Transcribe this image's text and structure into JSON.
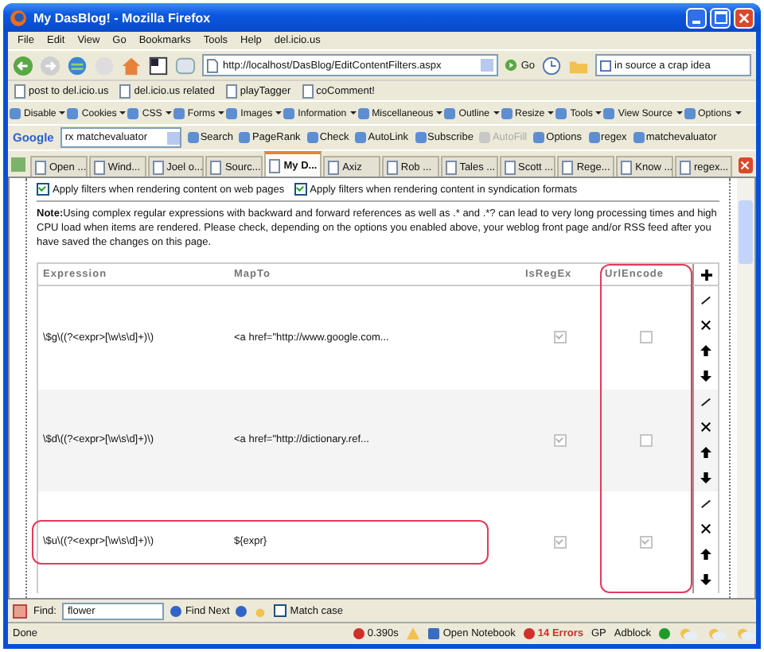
{
  "window": {
    "title": "My DasBlog! - Mozilla Firefox"
  },
  "menu": [
    "File",
    "Edit",
    "View",
    "Go",
    "Bookmarks",
    "Tools",
    "Help",
    "del.icio.us"
  ],
  "nav": {
    "url": "http://localhost/DasBlog/EditContentFilters.aspx",
    "go": "Go",
    "search_value": "in source a crap idea"
  },
  "bookmarks": [
    "post to del.icio.us",
    "del.icio.us related",
    "playTagger",
    "coComment!"
  ],
  "webdev_toolbar": [
    "Disable",
    "Cookies",
    "CSS",
    "Forms",
    "Images",
    "Information",
    "Miscellaneous",
    "Outline",
    "Resize",
    "Tools",
    "View Source",
    "Options"
  ],
  "google_toolbar": {
    "brand": "Google",
    "query": "rx matchevaluator",
    "items": [
      {
        "label": "Search",
        "disabled": false
      },
      {
        "label": "PageRank",
        "disabled": false
      },
      {
        "label": "Check",
        "disabled": false
      },
      {
        "label": "AutoLink",
        "disabled": false
      },
      {
        "label": "Subscribe",
        "disabled": false
      },
      {
        "label": "AutoFill",
        "disabled": true
      },
      {
        "label": "Options",
        "disabled": false
      },
      {
        "label": "regex",
        "disabled": false
      },
      {
        "label": "matchevaluator",
        "disabled": false
      }
    ]
  },
  "tabs": [
    {
      "label": "Open ...",
      "selected": false
    },
    {
      "label": "Wind...",
      "selected": false
    },
    {
      "label": "Joel o...",
      "selected": false
    },
    {
      "label": "Sourc...",
      "selected": false
    },
    {
      "label": "My D...",
      "selected": true
    },
    {
      "label": "Axiz",
      "selected": false
    },
    {
      "label": "Rob ...",
      "selected": false
    },
    {
      "label": "Tales ...",
      "selected": false
    },
    {
      "label": "Scott ...",
      "selected": false
    },
    {
      "label": "Rege...",
      "selected": false
    },
    {
      "label": "Know ...",
      "selected": false
    },
    {
      "label": "regex...",
      "selected": false
    }
  ],
  "options": [
    {
      "label": "Apply filters when rendering content on web pages",
      "checked": true
    },
    {
      "label": "Apply filters when rendering content in syndication formats",
      "checked": true
    }
  ],
  "note": "**Note:**Using complex regular expressions with backward and forward references as well as .* and .*? can lead to very long processing times and high CPU load when items are rendered. Please check, depending on the options you enabled above, your weblog front page and/or RSS feed after you have saved the changes on this page.",
  "table": {
    "columns": [
      {
        "label": "Expression",
        "highlighted": false
      },
      {
        "label": "MapTo",
        "highlighted": false
      },
      {
        "label": "IsRegEx",
        "highlighted": false
      },
      {
        "label": "UrlEncode",
        "highlighted": true
      }
    ],
    "rows": [
      {
        "expression": "\\$g\\((?<expr>[\\w\\s\\d]+)\\)",
        "map_to": "<a href=\"http://www.google.com...",
        "is_regex": true,
        "url_encode": false,
        "highlighted": false
      },
      {
        "expression": "\\$d\\((?<expr>[\\w\\s\\d]+)\\)",
        "map_to": "<a href=\"http://dictionary.ref...",
        "is_regex": true,
        "url_encode": false,
        "highlighted": false
      },
      {
        "expression": "\\$u\\((?<expr>[\\w\\s\\d]+)\\)",
        "map_to": "${expr}",
        "is_regex": true,
        "url_encode": true,
        "highlighted": true
      }
    ]
  },
  "find_bar": {
    "label": "Find:",
    "value": "flower",
    "find_next": "Find Next",
    "match_case": {
      "label": "Match case",
      "checked": false
    }
  },
  "status_bar": {
    "text": "Done",
    "timing": "0.390s",
    "notebook": "Open Notebook",
    "errors": "14 Errors",
    "gp": "GP",
    "adblock": "Adblock"
  }
}
